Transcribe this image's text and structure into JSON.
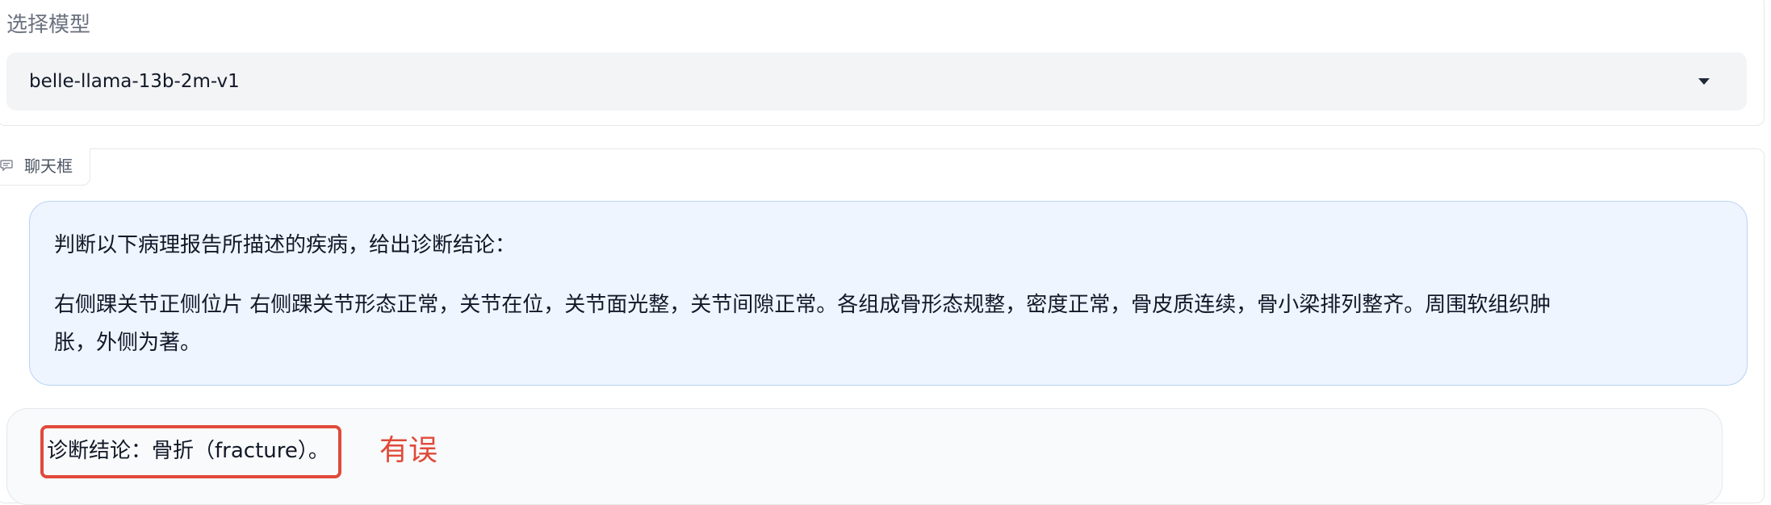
{
  "model_selector": {
    "label": "选择模型",
    "selected_value": "belle-llama-13b-2m-v1",
    "caret_icon": "chevron-down-icon"
  },
  "chatbox": {
    "tag_label": "聊天框",
    "tag_icon": "chat-bubble-icon",
    "messages": [
      {
        "role": "user",
        "lines": [
          "判断以下病理报告所描述的疾病，给出诊断结论：",
          "右侧踝关节正侧位片 右侧踝关节形态正常，关节在位，关节面光整，关节间隙正常。各组成骨形态规整，密度正常，骨皮质连续，骨小梁排列整齐。周围软组织肿",
          "胀，外侧为著。"
        ]
      },
      {
        "role": "bot",
        "text": "诊断结论：骨折（fracture）。"
      }
    ]
  },
  "annotation": {
    "text": "有误",
    "color": "#e04a3a"
  }
}
